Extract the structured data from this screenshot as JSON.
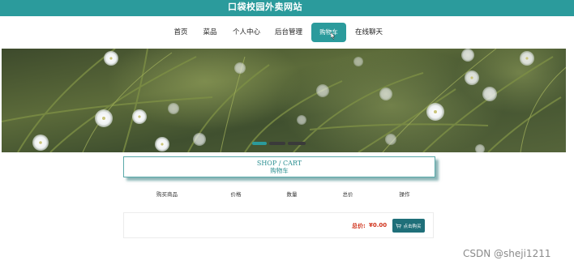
{
  "header": {
    "site_title": "口袋校园外卖网站",
    "color": "#2b9b9c"
  },
  "nav": {
    "items": [
      {
        "label": "首页",
        "active": false
      },
      {
        "label": "菜品",
        "active": false
      },
      {
        "label": "个人中心",
        "active": false
      },
      {
        "label": "后台管理",
        "active": false
      },
      {
        "label": "购物车",
        "active": true
      },
      {
        "label": "在线聊天",
        "active": false
      }
    ]
  },
  "banner": {
    "slider_dots": [
      "#2b9b9c",
      "#3a3a3a",
      "#3a3a3a"
    ]
  },
  "section_heading": {
    "english": "SHOP / CART",
    "chinese": "购物车"
  },
  "cart_table": {
    "columns": [
      "购买商品",
      "价格",
      "数量",
      "总价",
      "操作"
    ]
  },
  "cart_footer": {
    "total_label": "总价:",
    "total_value": "¥0.00",
    "buy_button_label": "点击购买",
    "buy_icon": "cart-icon"
  },
  "watermark": {
    "text": "CSDN @sheji1211"
  }
}
